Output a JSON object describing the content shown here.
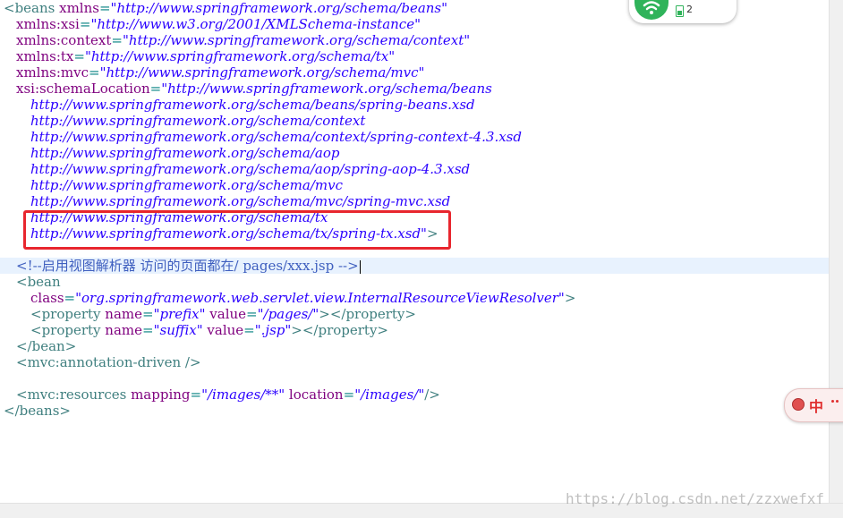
{
  "code": {
    "l1": {
      "open": "<beans",
      "attr": " xmlns",
      "eq": "=",
      "val": "\"http://www.springframework.org/schema/beans\""
    },
    "l2": {
      "attr": "xmlns:xsi",
      "eq": "=",
      "val": "\"http://www.w3.org/2001/XMLSchema-instance\""
    },
    "l3": {
      "attr": "xmlns:context",
      "eq": "=",
      "val": "\"http://www.springframework.org/schema/context\""
    },
    "l4": {
      "attr": "xmlns:tx",
      "eq": "=",
      "val": "\"http://www.springframework.org/schema/tx\""
    },
    "l5": {
      "attr": "xmlns:mvc",
      "eq": "=",
      "val": "\"http://www.springframework.org/schema/mvc\""
    },
    "l6": {
      "attr": "xsi:schemaLocation",
      "eq": "=",
      "val": "\"http://www.springframework.org/schema/beans"
    },
    "l7": "http://www.springframework.org/schema/beans/spring-beans.xsd",
    "l8": "http://www.springframework.org/schema/context",
    "l9": "http://www.springframework.org/schema/context/spring-context-4.3.xsd",
    "l10": "http://www.springframework.org/schema/aop",
    "l11": "http://www.springframework.org/schema/aop/spring-aop-4.3.xsd",
    "l12": "http://www.springframework.org/schema/mvc",
    "l13": "http://www.springframework.org/schema/mvc/spring-mvc.xsd",
    "l14": "http://www.springframework.org/schema/tx",
    "l15": {
      "val": "http://www.springframework.org/schema/tx/spring-tx.xsd\"",
      "close": ">"
    },
    "l16": "<!--启用视图解析器 访问的页面都在/ pages/xxx.jsp -->",
    "l17": "<bean",
    "l18": {
      "attr": "class",
      "eq": "=",
      "val": "\"org.springframework.web.servlet.view.InternalResourceViewResolver\"",
      "close": ">"
    },
    "l19": {
      "open": "<property",
      "attr1": " name",
      "eq1": "=",
      "val1": "\"prefix\"",
      "attr2": " value",
      "eq2": "=",
      "val2": "\"/pages/\"",
      "close": "></property>"
    },
    "l20": {
      "open": "<property",
      "attr1": " name",
      "eq1": "=",
      "val1": "\"suffix\"",
      "attr2": " value",
      "eq2": "=",
      "val2": "\".jsp\"",
      "close": "></property>"
    },
    "l21": "</bean>",
    "l22": "<mvc:annotation-driven />",
    "l23": {
      "open": "<mvc:resources",
      "attr1": " mapping",
      "eq1": "=",
      "val1": "\"/images/**\"",
      "attr2": " location",
      "eq2": "=",
      "val2": "\"/images/\"",
      "close": "/>"
    },
    "l24": "</beans>"
  },
  "network_widget": {
    "count": "2",
    "icons": [
      "wifi-icon",
      "battery-icon"
    ]
  },
  "ime": {
    "label": "中",
    "icon": "ime-logo"
  },
  "watermark": "https://blog.csdn.net/zzxwefxf",
  "colors": {
    "tag": "#3f7f7f",
    "attribute": "#7f007f",
    "value": "#2a00ff",
    "comment": "#3f5fbf",
    "highlight_box": "#e8262e",
    "current_line": "#e8f2fe"
  }
}
